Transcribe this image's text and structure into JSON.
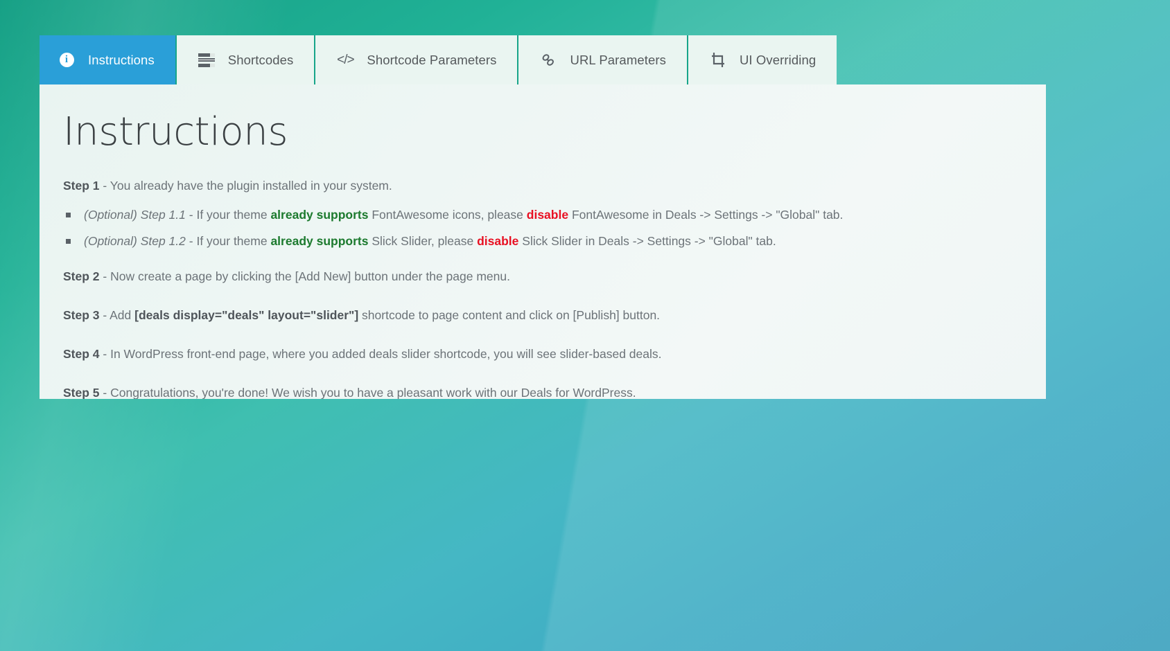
{
  "theme": {
    "accent_active_tab": "#2a9fd8",
    "tab_background": "#eaf5f1",
    "tab_divider": "#17a589",
    "panel_background": "#eef6f4",
    "background_gradient_from": "#16a085",
    "background_gradient_to": "#3aa0bd",
    "text_color": "#6c7378",
    "green_highlight": "#1c7a2e",
    "red_highlight": "#e81123"
  },
  "tabs": [
    {
      "id": "instructions",
      "label": "Instructions",
      "icon": "info-circle-icon",
      "active": true
    },
    {
      "id": "shortcodes",
      "label": "Shortcodes",
      "icon": "list-bars-icon",
      "active": false
    },
    {
      "id": "shortcode-parameters",
      "label": "Shortcode Parameters",
      "icon": "code-brackets-icon",
      "active": false
    },
    {
      "id": "url-parameters",
      "label": "URL Parameters",
      "icon": "chain-link-icon",
      "active": false
    },
    {
      "id": "ui-overriding",
      "label": "UI Overriding",
      "icon": "crop-icon",
      "active": false
    }
  ],
  "panel": {
    "title": "Instructions",
    "steps": [
      {
        "label": "Step 1",
        "separator": " - ",
        "text": "You already have the plugin installed in your system.",
        "sub_items": [
          {
            "optional_label": "(Optional) Step 1.1",
            "separator": " - ",
            "part1": "If your theme ",
            "green": "already supports",
            "part2": " FontAwesome icons, please ",
            "red": "disable",
            "part3": " FontAwesome in Deals -> Settings -> \"Global\" tab."
          },
          {
            "optional_label": "(Optional) Step 1.2",
            "separator": " - ",
            "part1": "If your theme ",
            "green": "already supports",
            "part2": " Slick Slider, please ",
            "red": "disable",
            "part3": " Slick Slider in Deals -> Settings -> \"Global\" tab."
          }
        ]
      },
      {
        "label": "Step 2",
        "separator": " - ",
        "text": "Now create a page by clicking the [Add New] button under the page menu."
      },
      {
        "label": "Step 3",
        "separator": " - ",
        "prefix": "Add ",
        "code": "[deals display=\"deals\" layout=\"slider\"]",
        "suffix": " shortcode to page content and click on [Publish] button."
      },
      {
        "label": "Step 4",
        "separator": " - ",
        "text": "In WordPress front-end page, where you added deals slider shortcode, you will see slider-based deals."
      },
      {
        "label": "Step 5",
        "separator": " - ",
        "text": "Congratulations, you're done! We wish you to have a pleasant work with our Deals for WordPress."
      }
    ]
  }
}
